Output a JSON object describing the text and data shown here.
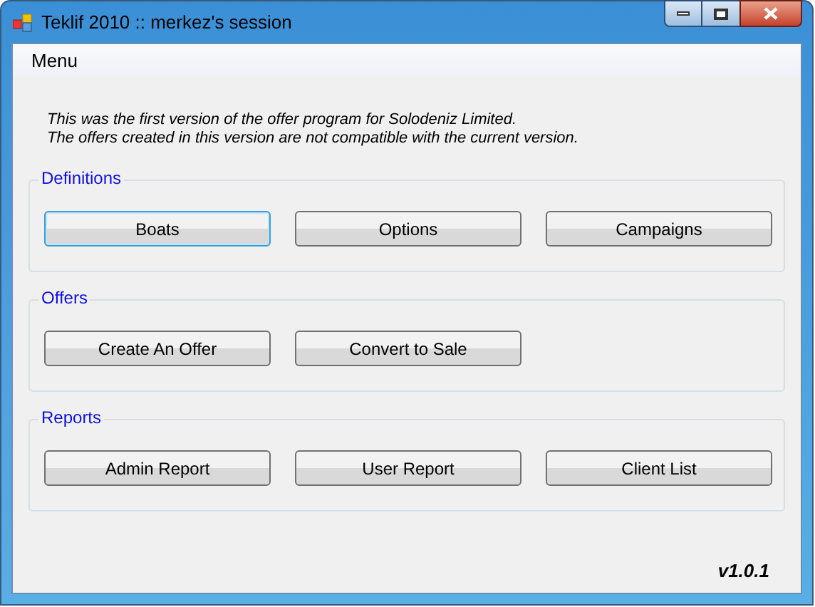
{
  "window": {
    "title": "Teklif 2010 :: merkez's session"
  },
  "menu": [
    "Menu"
  ],
  "notice": [
    "This was the first version of the offer program for Solodeniz Limited.",
    "The offers created in this version are not compatible with the current version."
  ],
  "groups": [
    {
      "title": "Definitions",
      "buttons": [
        {
          "label": "Boats",
          "focused": true
        },
        {
          "label": "Options",
          "focused": false
        },
        {
          "label": "Campaigns",
          "focused": false
        }
      ]
    },
    {
      "title": "Offers",
      "buttons": [
        {
          "label": "Create An Offer",
          "focused": false
        },
        {
          "label": "Convert to Sale",
          "focused": false
        }
      ]
    },
    {
      "title": "Reports",
      "buttons": [
        {
          "label": "Admin Report",
          "focused": false
        },
        {
          "label": "User Report",
          "focused": false
        },
        {
          "label": "Client List",
          "focused": false
        }
      ]
    }
  ],
  "version": "v1.0.1"
}
